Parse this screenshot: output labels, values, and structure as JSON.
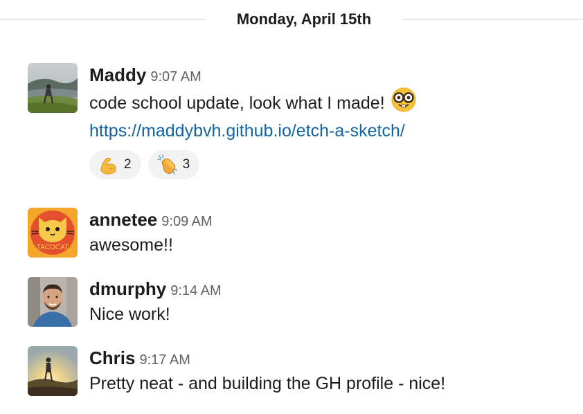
{
  "day_divider": {
    "label": "Monday, April 15th"
  },
  "messages": [
    {
      "author": "Maddy",
      "time": "9:07 AM",
      "text": "code school update, look what I made!",
      "inline_emoji": "nerd-face-emoji",
      "link": "https://maddybvh.github.io/etch-a-sketch/",
      "reactions": [
        {
          "emoji": "flexed-biceps-emoji",
          "count": "2"
        },
        {
          "emoji": "clapping-hands-emoji",
          "count": "3"
        }
      ]
    },
    {
      "author": "annetee",
      "time": "9:09 AM",
      "text": "awesome!!",
      "avatar_text": "TACOCAT"
    },
    {
      "author": "dmurphy",
      "time": "9:14 AM",
      "text": "Nice work!"
    },
    {
      "author": "Chris",
      "time": "9:17 AM",
      "text": "Pretty neat - and building the GH profile - nice!"
    }
  ],
  "colors": {
    "link": "#1264a3",
    "timestamp": "#616061",
    "reaction_bg": "#f2f2f2",
    "divider": "#dddddd"
  }
}
